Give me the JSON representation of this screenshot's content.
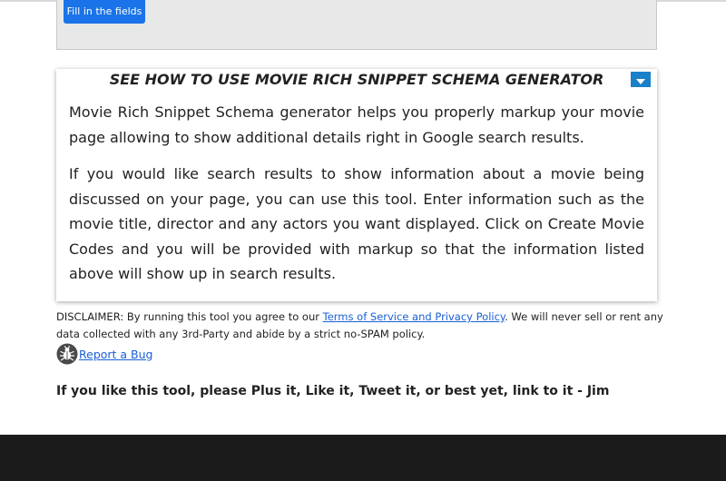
{
  "form": {
    "fill_button_label": "Fill in the fields"
  },
  "howto": {
    "title": "SEE HOW TO USE MOVIE RICH SNIPPET SCHEMA GENERATOR",
    "toggle_icon": "triangle-down-icon",
    "paragraphs": [
      "Movie Rich Snippet Schema generator helps you properly markup your movie page allowing to show additional details right in Google search results.",
      "If you would like search results to show information about a movie being discussed on your page, you can use this tool. Enter information such as the movie title, director and any actors you want displayed. Click on Create Movie Codes and you will be provided with markup so that the information listed above will show up in search results."
    ]
  },
  "disclaimer": {
    "prefix": "DISCLAIMER: By running this tool you agree to our ",
    "link_text": "Terms of Service and Privacy Policy",
    "suffix": ". We will never sell or rent any data collected with any 3rd-Party and abide by a strict no-SPAM policy."
  },
  "bug_report": {
    "icon": "bug-icon",
    "link_text": "Report a Bug"
  },
  "like_line": "If you like this tool, please Plus it, Like it, Tweet it, or best yet, link to it - Jim",
  "colors": {
    "accent_blue": "#1a73e8",
    "toggle_blue": "#1a80c8",
    "link_blue": "#1a5fd4",
    "footer_dark": "#1b1b1b"
  }
}
